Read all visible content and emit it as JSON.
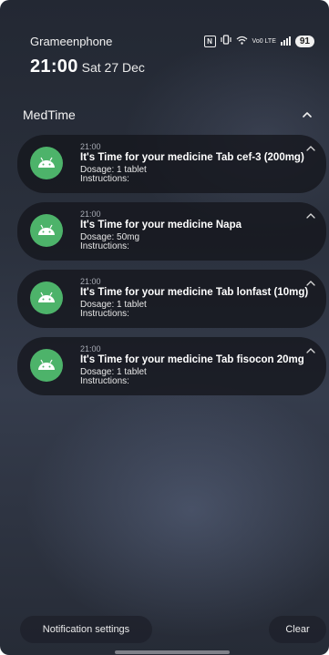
{
  "status_bar": {
    "carrier": "Grameenphone",
    "network_label": "Vo0 LTE",
    "battery": "91",
    "icons": [
      "nfc-icon",
      "vibrate-icon",
      "wifi-icon",
      "lte-icon",
      "signal-icon",
      "battery-icon"
    ]
  },
  "clock": {
    "time": "21:00",
    "date": "Sat 27 Dec"
  },
  "group": {
    "app_name": "MedTime",
    "icon": "chevron-up-icon"
  },
  "notifications": [
    {
      "time": "21:00",
      "title": "It's Time for your medicine Tab cef-3 (200mg)",
      "dosage": "Dosage: 1 tablet",
      "instructions": "Instructions:",
      "icon": "android-app-icon"
    },
    {
      "time": "21:00",
      "title": "It's Time for your medicine Napa",
      "dosage": "Dosage: 50mg",
      "instructions": "Instructions:",
      "icon": "android-app-icon"
    },
    {
      "time": "21:00",
      "title": "It's Time for your medicine Tab lonfast (10mg)",
      "dosage": "Dosage: 1 tablet",
      "instructions": "Instructions:",
      "icon": "android-app-icon"
    },
    {
      "time": "21:00",
      "title": "It's Time for your medicine Tab fisocon 20mg",
      "dosage": "Dosage: 1 tablet",
      "instructions": "Instructions:",
      "icon": "android-app-icon"
    }
  ],
  "actions": {
    "settings_label": "Notification settings",
    "clear_label": "Clear"
  },
  "colors": {
    "app_icon_bg": "#4db36a",
    "card_bg": "#14161c"
  }
}
